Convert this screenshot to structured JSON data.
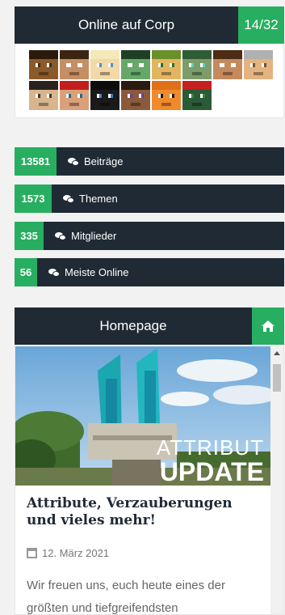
{
  "online": {
    "title": "Online auf Corp",
    "count": "14/32",
    "avatars": [
      {
        "skin": "#8b5a2b",
        "hair": "#2b1a0c",
        "eye": "#3a2a1a"
      },
      {
        "skin": "#c58e63",
        "hair": "#3b2412",
        "eye": "#ffffff"
      },
      {
        "skin": "#f1d9a8",
        "hair": "#f4e9b8",
        "eye": "#5c8fb8"
      },
      {
        "skin": "#66a86a",
        "hair": "#1f3f25",
        "eye": "#ffffff"
      },
      {
        "skin": "#e2b560",
        "hair": "#6a8f2b",
        "eye": "#2a6f2a"
      },
      {
        "skin": "#7c9d6a",
        "hair": "#2f5c34",
        "eye": "#5fd0c0"
      },
      {
        "skin": "#c48a5c",
        "hair": "#4d2b14",
        "eye": "#ffffff"
      },
      {
        "skin": "#e4b37f",
        "hair": "#b0b0b0",
        "eye": "#7a5030"
      },
      {
        "skin": "#d8b58c",
        "hair": "#2a221c",
        "eye": "#3a3a3a"
      },
      {
        "skin": "#d9a07a",
        "hair": "#c21d1d",
        "eye": "#1f6a8c"
      },
      {
        "skin": "#1a1a1a",
        "hair": "#0d0d0d",
        "eye": "#3e7cc4"
      },
      {
        "skin": "#8a5a3c",
        "hair": "#2b1a10",
        "eye": "#6a3a9a"
      },
      {
        "skin": "#f08a2c",
        "hair": "#e07018",
        "eye": "#1a1a1a"
      },
      {
        "skin": "#2a5a36",
        "hair": "#c42020",
        "eye": "#3a8a3a"
      }
    ]
  },
  "stats": [
    {
      "number": "13581",
      "label": "Beiträge"
    },
    {
      "number": "1573",
      "label": "Themen"
    },
    {
      "number": "335",
      "label": "Mitglieder"
    },
    {
      "number": "56",
      "label": "Meiste Online"
    }
  ],
  "homepage": {
    "title": "Homepage",
    "image_text_1": "ATTRIBUT",
    "image_text_2": "UPDATE",
    "post_title": "Attribute, Verzauberungen und vieles mehr!",
    "post_date": "12. März 2021",
    "post_text": "Wir freuen uns, euch heute eines der größten und tiefgreifendsten"
  },
  "colors": {
    "accent": "#27ae60",
    "header": "#1f2a34"
  }
}
